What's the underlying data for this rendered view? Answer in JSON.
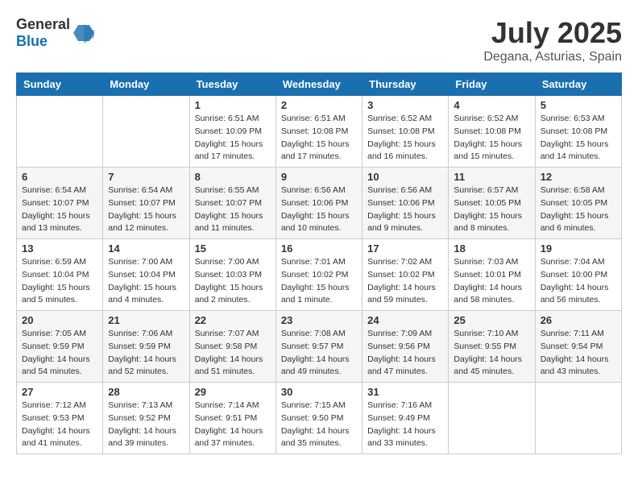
{
  "header": {
    "logo_general": "General",
    "logo_blue": "Blue",
    "month_year": "July 2025",
    "location": "Degana, Asturias, Spain"
  },
  "weekdays": [
    "Sunday",
    "Monday",
    "Tuesday",
    "Wednesday",
    "Thursday",
    "Friday",
    "Saturday"
  ],
  "weeks": [
    [
      {
        "day": "",
        "info": ""
      },
      {
        "day": "",
        "info": ""
      },
      {
        "day": "1",
        "info": "Sunrise: 6:51 AM\nSunset: 10:09 PM\nDaylight: 15 hours\nand 17 minutes."
      },
      {
        "day": "2",
        "info": "Sunrise: 6:51 AM\nSunset: 10:08 PM\nDaylight: 15 hours\nand 17 minutes."
      },
      {
        "day": "3",
        "info": "Sunrise: 6:52 AM\nSunset: 10:08 PM\nDaylight: 15 hours\nand 16 minutes."
      },
      {
        "day": "4",
        "info": "Sunrise: 6:52 AM\nSunset: 10:08 PM\nDaylight: 15 hours\nand 15 minutes."
      },
      {
        "day": "5",
        "info": "Sunrise: 6:53 AM\nSunset: 10:08 PM\nDaylight: 15 hours\nand 14 minutes."
      }
    ],
    [
      {
        "day": "6",
        "info": "Sunrise: 6:54 AM\nSunset: 10:07 PM\nDaylight: 15 hours\nand 13 minutes."
      },
      {
        "day": "7",
        "info": "Sunrise: 6:54 AM\nSunset: 10:07 PM\nDaylight: 15 hours\nand 12 minutes."
      },
      {
        "day": "8",
        "info": "Sunrise: 6:55 AM\nSunset: 10:07 PM\nDaylight: 15 hours\nand 11 minutes."
      },
      {
        "day": "9",
        "info": "Sunrise: 6:56 AM\nSunset: 10:06 PM\nDaylight: 15 hours\nand 10 minutes."
      },
      {
        "day": "10",
        "info": "Sunrise: 6:56 AM\nSunset: 10:06 PM\nDaylight: 15 hours\nand 9 minutes."
      },
      {
        "day": "11",
        "info": "Sunrise: 6:57 AM\nSunset: 10:05 PM\nDaylight: 15 hours\nand 8 minutes."
      },
      {
        "day": "12",
        "info": "Sunrise: 6:58 AM\nSunset: 10:05 PM\nDaylight: 15 hours\nand 6 minutes."
      }
    ],
    [
      {
        "day": "13",
        "info": "Sunrise: 6:59 AM\nSunset: 10:04 PM\nDaylight: 15 hours\nand 5 minutes."
      },
      {
        "day": "14",
        "info": "Sunrise: 7:00 AM\nSunset: 10:04 PM\nDaylight: 15 hours\nand 4 minutes."
      },
      {
        "day": "15",
        "info": "Sunrise: 7:00 AM\nSunset: 10:03 PM\nDaylight: 15 hours\nand 2 minutes."
      },
      {
        "day": "16",
        "info": "Sunrise: 7:01 AM\nSunset: 10:02 PM\nDaylight: 15 hours\nand 1 minute."
      },
      {
        "day": "17",
        "info": "Sunrise: 7:02 AM\nSunset: 10:02 PM\nDaylight: 14 hours\nand 59 minutes."
      },
      {
        "day": "18",
        "info": "Sunrise: 7:03 AM\nSunset: 10:01 PM\nDaylight: 14 hours\nand 58 minutes."
      },
      {
        "day": "19",
        "info": "Sunrise: 7:04 AM\nSunset: 10:00 PM\nDaylight: 14 hours\nand 56 minutes."
      }
    ],
    [
      {
        "day": "20",
        "info": "Sunrise: 7:05 AM\nSunset: 9:59 PM\nDaylight: 14 hours\nand 54 minutes."
      },
      {
        "day": "21",
        "info": "Sunrise: 7:06 AM\nSunset: 9:59 PM\nDaylight: 14 hours\nand 52 minutes."
      },
      {
        "day": "22",
        "info": "Sunrise: 7:07 AM\nSunset: 9:58 PM\nDaylight: 14 hours\nand 51 minutes."
      },
      {
        "day": "23",
        "info": "Sunrise: 7:08 AM\nSunset: 9:57 PM\nDaylight: 14 hours\nand 49 minutes."
      },
      {
        "day": "24",
        "info": "Sunrise: 7:09 AM\nSunset: 9:56 PM\nDaylight: 14 hours\nand 47 minutes."
      },
      {
        "day": "25",
        "info": "Sunrise: 7:10 AM\nSunset: 9:55 PM\nDaylight: 14 hours\nand 45 minutes."
      },
      {
        "day": "26",
        "info": "Sunrise: 7:11 AM\nSunset: 9:54 PM\nDaylight: 14 hours\nand 43 minutes."
      }
    ],
    [
      {
        "day": "27",
        "info": "Sunrise: 7:12 AM\nSunset: 9:53 PM\nDaylight: 14 hours\nand 41 minutes."
      },
      {
        "day": "28",
        "info": "Sunrise: 7:13 AM\nSunset: 9:52 PM\nDaylight: 14 hours\nand 39 minutes."
      },
      {
        "day": "29",
        "info": "Sunrise: 7:14 AM\nSunset: 9:51 PM\nDaylight: 14 hours\nand 37 minutes."
      },
      {
        "day": "30",
        "info": "Sunrise: 7:15 AM\nSunset: 9:50 PM\nDaylight: 14 hours\nand 35 minutes."
      },
      {
        "day": "31",
        "info": "Sunrise: 7:16 AM\nSunset: 9:49 PM\nDaylight: 14 hours\nand 33 minutes."
      },
      {
        "day": "",
        "info": ""
      },
      {
        "day": "",
        "info": ""
      }
    ]
  ]
}
